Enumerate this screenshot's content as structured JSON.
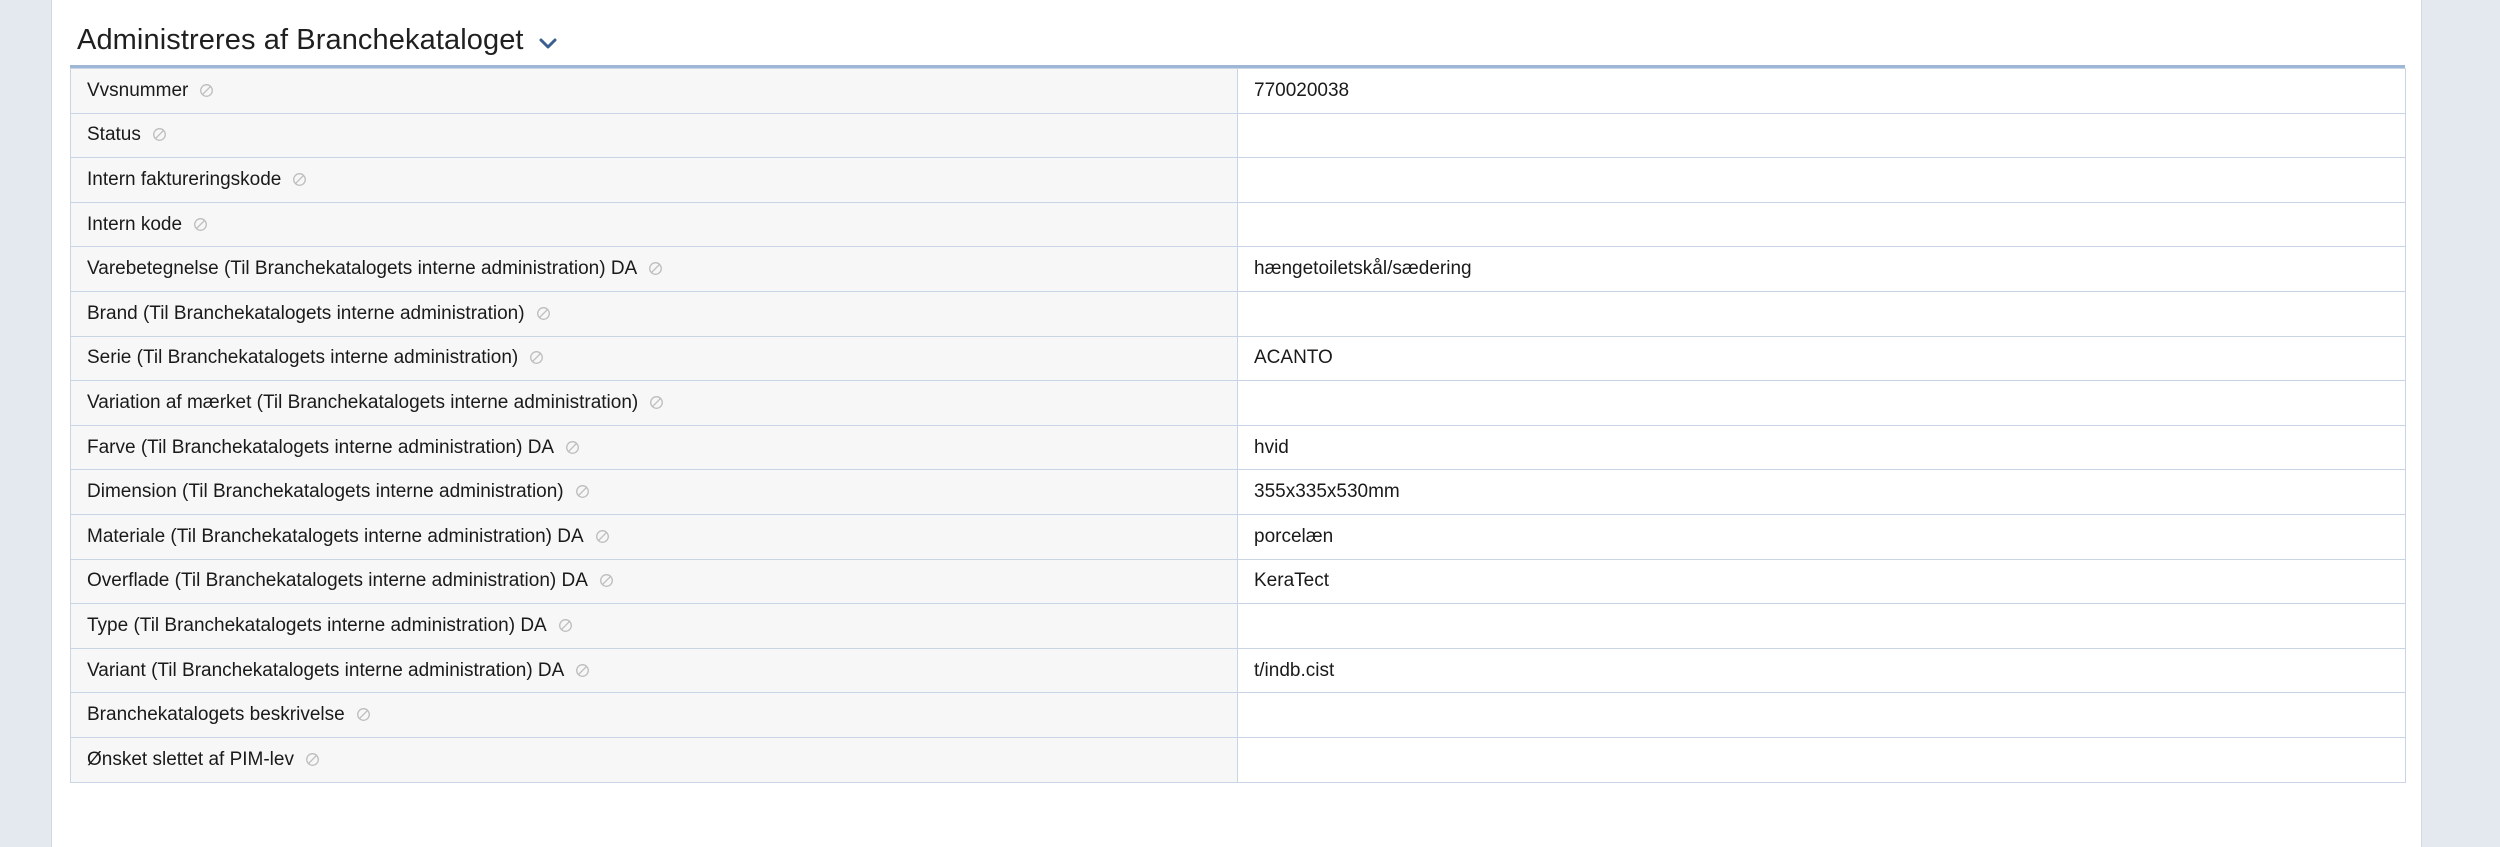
{
  "section": {
    "title": "Administreres af Branchekataloget",
    "toggle_icon": "chevron-down-icon"
  },
  "colors": {
    "accent": "#3b5f91",
    "border": "#c9d4e4",
    "header_rule": "#9fb7d6",
    "page_bg": "#e4e8ef"
  },
  "rows": [
    {
      "label": "Vvsnummer",
      "value": "770020038",
      "icon": "readonly-icon"
    },
    {
      "label": "Status",
      "value": "",
      "icon": "readonly-icon"
    },
    {
      "label": "Intern faktureringskode",
      "value": "",
      "icon": "readonly-icon"
    },
    {
      "label": "Intern kode",
      "value": "",
      "icon": "readonly-icon"
    },
    {
      "label": "Varebetegnelse (Til Branchekatalogets interne administration) DA",
      "value": "hængetoiletskål/sædering",
      "icon": "readonly-icon"
    },
    {
      "label": "Brand (Til Branchekatalogets interne administration)",
      "value": "",
      "icon": "readonly-icon"
    },
    {
      "label": "Serie (Til Branchekatalogets interne administration)",
      "value": "ACANTO",
      "icon": "readonly-icon"
    },
    {
      "label": "Variation af mærket (Til Branchekatalogets interne administration)",
      "value": "",
      "icon": "readonly-icon"
    },
    {
      "label": "Farve (Til Branchekatalogets interne administration) DA",
      "value": "hvid",
      "icon": "readonly-icon"
    },
    {
      "label": "Dimension (Til Branchekatalogets interne administration)",
      "value": "355x335x530mm",
      "icon": "readonly-icon"
    },
    {
      "label": "Materiale (Til Branchekatalogets interne administration) DA",
      "value": "porcelæn",
      "icon": "readonly-icon"
    },
    {
      "label": "Overflade (Til Branchekatalogets interne administration) DA",
      "value": "KeraTect",
      "icon": "readonly-icon"
    },
    {
      "label": "Type (Til Branchekatalogets interne administration) DA",
      "value": "",
      "icon": "readonly-icon"
    },
    {
      "label": "Variant (Til Branchekatalogets interne administration) DA",
      "value": "t/indb.cist",
      "icon": "readonly-icon"
    },
    {
      "label": "Branchekatalogets beskrivelse",
      "value": "",
      "icon": "readonly-icon"
    },
    {
      "label": "Ønsket slettet af PIM-lev",
      "value": "",
      "icon": "readonly-icon"
    }
  ]
}
